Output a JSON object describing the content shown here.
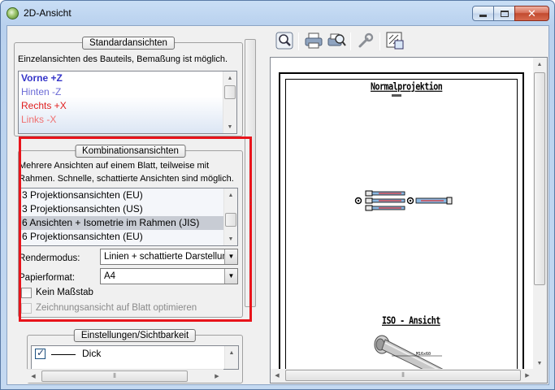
{
  "window": {
    "title": "2D-Ansicht",
    "close_glyph": "✕"
  },
  "standard": {
    "group_title": "Standardansichten",
    "description": "Einzelansichten des Bauteils, Bemaßung ist möglich.",
    "items": [
      {
        "label": "Vorne +Z",
        "color": "#3535c8"
      },
      {
        "label": "Hinten -Z",
        "color": "#6a6ad6"
      },
      {
        "label": "Rechts +X",
        "color": "#e02020"
      },
      {
        "label": "Links -X",
        "color": "#f07070"
      }
    ]
  },
  "combination": {
    "group_title": "Kombinationsansichten",
    "description_line1": "Mehrere Ansichten auf einem Blatt, teilweise mit",
    "description_line2": "Rahmen. Schnelle, schattierte Ansichten sind möglich.",
    "items": [
      {
        "label": "3 Projektionsansichten (EU)",
        "selected": false
      },
      {
        "label": "3 Projektionsansichten (US)",
        "selected": false
      },
      {
        "label": "6 Ansichten + Isometrie im Rahmen (JIS)",
        "selected": true
      },
      {
        "label": "6 Projektionsansichten (EU)",
        "selected": false
      }
    ],
    "render_label": "Rendermodus:",
    "render_value": "Linien + schattierte Darstellung",
    "paper_label": "Papierformat:",
    "paper_value": "A4",
    "no_scale_label": "Kein Maßstab",
    "optimize_label": "Zeichnungsansicht auf Blatt optimieren"
  },
  "settings": {
    "group_title": "Einstellungen/Sichtbarkeit",
    "items": [
      {
        "label": "Dick",
        "checked": true
      }
    ]
  },
  "toolbar": {
    "icons": [
      "zoom-icon",
      "print-icon",
      "print-preview-icon",
      "wrench-icon",
      "export-icon"
    ]
  },
  "drawing": {
    "projection_title": "Normalprojektion",
    "iso_title": "ISO - Ansicht",
    "iso_dim": "M16x60"
  }
}
